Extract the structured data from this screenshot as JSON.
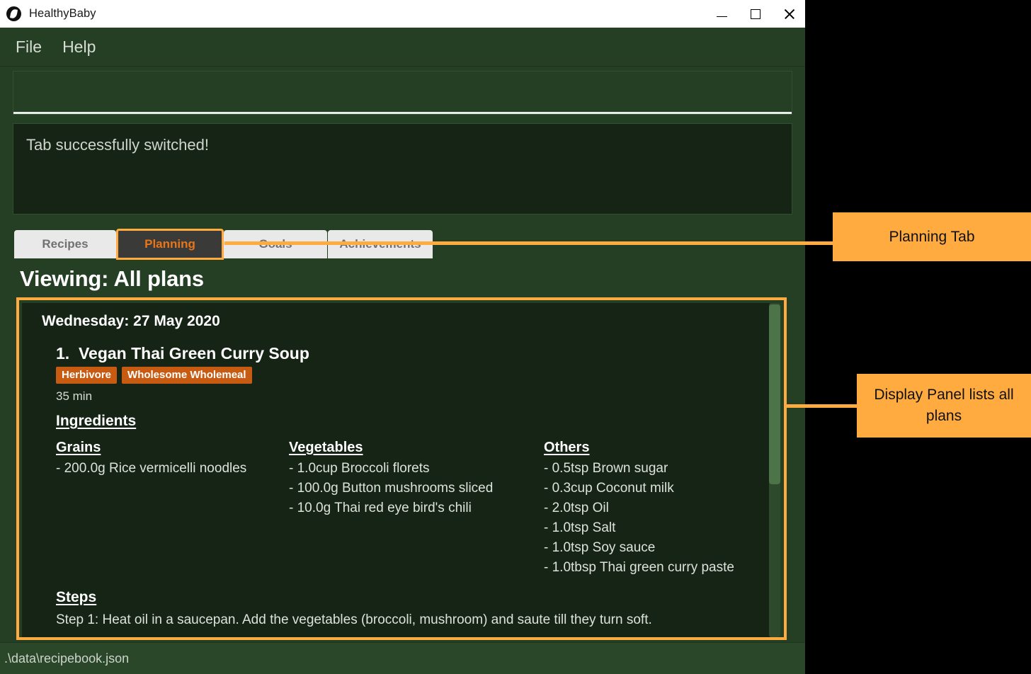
{
  "window": {
    "title": "HealthyBaby",
    "icon": "leaf-icon",
    "controls": {
      "minimize": "minimize-icon",
      "maximize": "maximize-icon",
      "close": "close-icon"
    }
  },
  "menu": {
    "items": [
      {
        "label": "File"
      },
      {
        "label": "Help"
      }
    ]
  },
  "command_entry": {
    "value": "",
    "placeholder": ""
  },
  "message_box": {
    "text": "Tab successfully switched!"
  },
  "tabs": [
    {
      "label": "Recipes",
      "active": false
    },
    {
      "label": "Planning",
      "active": true
    },
    {
      "label": "Goals",
      "active": false
    },
    {
      "label": "Achievements",
      "active": false
    }
  ],
  "content": {
    "viewing_title": "Viewing: All plans"
  },
  "plan": {
    "date": "Wednesday: 27 May 2020",
    "recipe_title": "1.  Vegan Thai Green Curry Soup",
    "tags": [
      {
        "label": "Herbivore"
      },
      {
        "label": "Wholesome Wholemeal"
      }
    ],
    "duration": "35 min",
    "ingredients_heading": "Ingredients",
    "ingredient_groups": [
      {
        "name": "Grains",
        "items": [
          "- 200.0g Rice vermicelli noodles"
        ]
      },
      {
        "name": "Vegetables",
        "items": [
          "- 1.0cup Broccoli florets",
          "- 100.0g Button mushrooms sliced",
          "- 10.0g Thai red eye bird's chili"
        ]
      },
      {
        "name": "Others",
        "items": [
          "- 0.5tsp Brown sugar",
          "- 0.3cup Coconut milk",
          "- 2.0tsp Oil",
          "- 1.0tsp Salt",
          "- 1.0tsp Soy sauce",
          "- 1.0tbsp Thai green curry paste"
        ]
      }
    ],
    "steps_heading": "Steps",
    "steps": [
      "Step 1: Heat oil in a saucepan. Add the vegetables (broccoli, mushroom) and saute till they turn soft."
    ]
  },
  "status_bar": {
    "text": ".\\data\\recipebook.json"
  },
  "annotations": [
    {
      "text": "Planning Tab"
    },
    {
      "text": "Display Panel lists all plans"
    }
  ],
  "colors": {
    "window_bg": "#253f24",
    "panel_bg": "#152414",
    "accent_orange": "#ffab40",
    "tab_active_text": "#e8751a",
    "tag_bg": "#c75b12",
    "titlebar_bg": "#ffffff"
  }
}
